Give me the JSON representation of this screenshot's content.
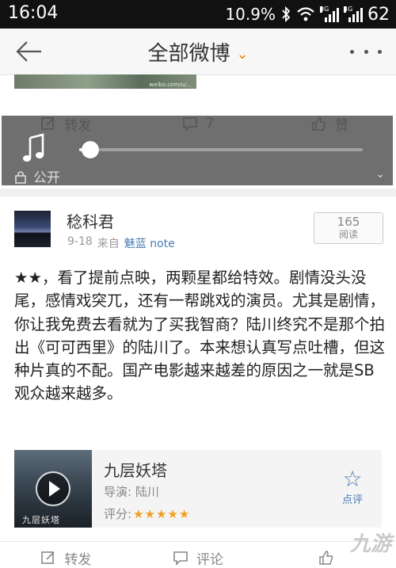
{
  "status_bar": {
    "time": "16:04",
    "battery_pct": "10.9%",
    "battery_level": "62",
    "tag_3g": "3G",
    "tag_4g": "4G"
  },
  "header": {
    "title": "全部微博"
  },
  "prev_post": {
    "image_watermark": "weibo.com/u/...",
    "actions": [
      {
        "label": "转发"
      },
      {
        "label": "7"
      },
      {
        "label": "赞"
      }
    ],
    "visibility": "公开"
  },
  "music_player": {
    "progress": 0.04
  },
  "post": {
    "username": "稔科君",
    "date": "9-18",
    "source_prefix": "来自",
    "source": "魅蓝 note",
    "read_count": "165",
    "read_label": "阅读",
    "text": "★★，看了提前点映，两颗星都给特效。剧情没头没尾，感情戏突兀，还有一帮跳戏的演员。尤其是剧情，你让我免费去看就为了买我智商？陆川终究不是那个拍出《可可西里》的陆川了。本来想认真写点吐槽，但这种片真的不配。国产电影越来越差的原因之一就是SB观众越来越多。",
    "movie": {
      "title": "九层妖塔",
      "poster_caption": "九层妖塔",
      "director": "导演: 陆川",
      "rating_label": "评分:",
      "stars": 4.5,
      "rate_label": "点评"
    },
    "actions": [
      {
        "label": "转发"
      },
      {
        "label": "评论"
      },
      {
        "label": ""
      }
    ]
  },
  "watermark": "九游"
}
